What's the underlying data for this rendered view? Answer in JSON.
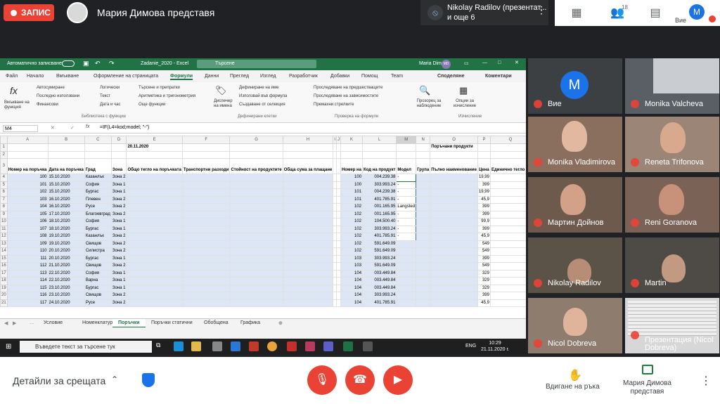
{
  "meet": {
    "record_label": "ЗАПИС",
    "presenter_title": "Мария Димова представя",
    "pinned": {
      "line1": "Nikolay Radilov (презентат...",
      "line2": "и още 6"
    },
    "people_count": "18",
    "self_label": "Вие",
    "self_initial": "M",
    "details_label": "Детайли за срещата",
    "raise_hand_label": "Вдигане на ръка",
    "presenting_label1": "Мария Димова",
    "presenting_label2": "представя"
  },
  "participants": [
    {
      "name": "Вие"
    },
    {
      "name": "Monika Valcheva"
    },
    {
      "name": "Monika Vladimirova"
    },
    {
      "name": "Reneta Trifonova"
    },
    {
      "name": "Мартин Дойнов"
    },
    {
      "name": "Reni Goranova"
    },
    {
      "name": "Nikolay Radilov"
    },
    {
      "name": "Martin"
    },
    {
      "name": "Nicol Dobreva"
    },
    {
      "name": "Презентация (Nicol Dobreva)"
    }
  ],
  "excel": {
    "autosave": "Автоматично записване",
    "filename": "Zadanie_2020 - Excel",
    "search": "Търсене",
    "user": "Maria Dimova",
    "user_initials": "MD",
    "menus": [
      "Файл",
      "Начало",
      "Вмъкване",
      "Оформление на страницата",
      "Формули",
      "Данни",
      "Преглед",
      "Изглед",
      "Разработчик",
      "Добавки",
      "Помощ",
      "Team"
    ],
    "share": "Споделяне",
    "comments": "Коментари",
    "ribbon": {
      "insert_fn": "Вмъкване на функция",
      "autosum": "Автосумиране",
      "recent": "Последно използвани",
      "financial": "Финансови",
      "logical": "Логически",
      "text": "Текст",
      "datetime": "Дата и час",
      "lookup": "Търсене и препратки",
      "math": "Аритметика и тригонометрия",
      "more": "Още функции",
      "lib_group": "Библиотека с функции",
      "name_mgr": "Диспечер на имена",
      "define": "Дефиниране на име",
      "use_formula": "Използвай във формула",
      "create_sel": "Създаване от селекция",
      "names_group": "Дефинирани клетки",
      "trace_prec": "Проследяване на предшестващите",
      "trace_dep": "Проследяване на зависимостите",
      "remove_arrows": "Премахни стрелките",
      "audit_group": "Проверка на формули",
      "watch": "Прозорец за наблюдение",
      "calc": "Опции за изчисление",
      "calc_group": "Изчисление"
    },
    "namebox": "M4",
    "formula": "=IF(L4=kod;model; \"-\")",
    "tabs": [
      "Условие",
      "Номенклатури",
      "Поръчки",
      "Поръчки статични",
      "Обобщена",
      "Графика"
    ],
    "active_tab": "Поръчки"
  },
  "sheet": {
    "columns": [
      "A",
      "B",
      "C",
      "D",
      "E",
      "F",
      "G",
      "H",
      "I",
      "J",
      "K",
      "L",
      "M",
      "N",
      "O",
      "P",
      "Q"
    ],
    "date": "20.11.2020",
    "section_title": "Поръчани продукти",
    "headers": {
      "A": "Номер на поръчка",
      "B": "Дата на поръчка",
      "C": "Град",
      "D": "Зона",
      "E": "Общо тегло на поръчката",
      "F": "Транспортни разходи",
      "G": "Стойност на продуктите",
      "H": "Обща сума за плащане",
      "K": "Номер на",
      "L": "Код на продукт",
      "M": "Модел",
      "N": "Група",
      "O": "Пълно наименование",
      "P": "Цена",
      "Q": "Единично тегло (к"
    },
    "rows": [
      {
        "r": "4",
        "a": "100",
        "b": "15.10.2020",
        "c": "Казанлък",
        "d": "Зона 2",
        "k": "100",
        "l": "004.239.38",
        "m": "-",
        "p": "19,99"
      },
      {
        "r": "5",
        "a": "101",
        "b": "15.10.2020",
        "c": "София",
        "d": "Зона 1",
        "k": "100",
        "l": "303.993.24",
        "m": "-",
        "p": "399"
      },
      {
        "r": "6",
        "a": "102",
        "b": "15.10.2020",
        "c": "Бургас",
        "d": "Зона 1",
        "k": "101",
        "l": "004.239.38",
        "m": "-",
        "p": "19,99"
      },
      {
        "r": "7",
        "a": "103",
        "b": "16.10.2020",
        "c": "Плевен",
        "d": "Зона 2",
        "k": "101",
        "l": "401.785.91",
        "m": "-",
        "p": "45,9"
      },
      {
        "r": "8",
        "a": "104",
        "b": "16.10.2020",
        "c": "Русе",
        "d": "Зона 2",
        "k": "102",
        "l": "001.165.95",
        "m": "Langsted",
        "p": "399"
      },
      {
        "r": "9",
        "a": "105",
        "b": "17.10.2020",
        "c": "Благоевград",
        "d": "Зона 2",
        "k": "102",
        "l": "001.165.95",
        "m": "-",
        "p": "399"
      },
      {
        "r": "10",
        "a": "106",
        "b": "18.10.2020",
        "c": "София",
        "d": "Зона 1",
        "k": "102",
        "l": "104.500.40",
        "m": "-",
        "p": "99,9"
      },
      {
        "r": "11",
        "a": "107",
        "b": "18.10.2020",
        "c": "Бургас",
        "d": "Зона 1",
        "k": "102",
        "l": "303.993.24",
        "m": "-",
        "p": "399"
      },
      {
        "r": "12",
        "a": "108",
        "b": "19.10.2020",
        "c": "Казанлък",
        "d": "Зона 2",
        "k": "102",
        "l": "401.785.91",
        "m": "-",
        "p": "45,9"
      },
      {
        "r": "13",
        "a": "109",
        "b": "19.10.2020",
        "c": "Свищов",
        "d": "Зона 2",
        "k": "102",
        "l": "591.649.09",
        "m": "",
        "p": "549"
      },
      {
        "r": "14",
        "a": "110",
        "b": "20.10.2020",
        "c": "Силистра",
        "d": "Зона 2",
        "k": "102",
        "l": "591.649.09",
        "m": "",
        "p": "549"
      },
      {
        "r": "15",
        "a": "111",
        "b": "20.10.2020",
        "c": "Бургас",
        "d": "Зона 1",
        "k": "103",
        "l": "303.993.24",
        "m": "",
        "p": "399"
      },
      {
        "r": "16",
        "a": "112",
        "b": "21.10.2020",
        "c": "Свищов",
        "d": "Зона 2",
        "k": "103",
        "l": "591.649.09",
        "m": "",
        "p": "549"
      },
      {
        "r": "17",
        "a": "113",
        "b": "22.10.2020",
        "c": "София",
        "d": "Зона 1",
        "k": "104",
        "l": "003.449.84",
        "m": "",
        "p": "329"
      },
      {
        "r": "18",
        "a": "114",
        "b": "22.10.2020",
        "c": "Варна",
        "d": "Зона 1",
        "k": "104",
        "l": "003.449.84",
        "m": "",
        "p": "329"
      },
      {
        "r": "19",
        "a": "115",
        "b": "23.10.2020",
        "c": "Бургас",
        "d": "Зона 1",
        "k": "104",
        "l": "003.449.84",
        "m": "",
        "p": "329"
      },
      {
        "r": "20",
        "a": "116",
        "b": "23.10.2020",
        "c": "Свищов",
        "d": "Зона 2",
        "k": "104",
        "l": "303.993.24",
        "m": "",
        "p": "399"
      },
      {
        "r": "21",
        "a": "117",
        "b": "24.10.2020",
        "c": "Русе",
        "d": "Зона 2",
        "k": "104",
        "l": "401.785.91",
        "m": "",
        "p": "45,9"
      }
    ]
  },
  "taskbar": {
    "search": "Въведете текст за търсене тук",
    "lang": "ENG",
    "time": "10:29",
    "date": "21.11.2020 г."
  }
}
